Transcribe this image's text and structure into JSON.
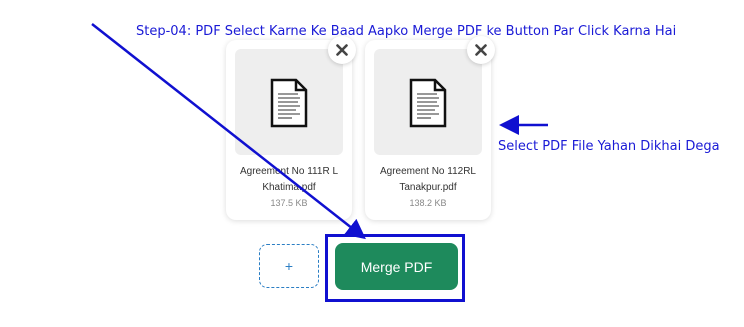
{
  "annotations": {
    "step_text": "Step-04: PDF Select Karne Ke Baad Aapko Merge PDF ke Button Par Click Karna Hai",
    "side_text": "Select PDF File Yahan Dikhai Dega",
    "color": "#1a1ad6"
  },
  "files": [
    {
      "name": "Agreement No 111R L Khatima.pdf",
      "size": "137.5 KB",
      "icon": "document-icon",
      "remove_icon": "close-icon"
    },
    {
      "name": "Agreement No 112RL Tanakpur.pdf",
      "size": "138.2 KB",
      "icon": "document-icon",
      "remove_icon": "close-icon"
    }
  ],
  "add_button": {
    "label": "+"
  },
  "merge_button": {
    "label": "Merge PDF",
    "color": "#1e8a5c"
  }
}
